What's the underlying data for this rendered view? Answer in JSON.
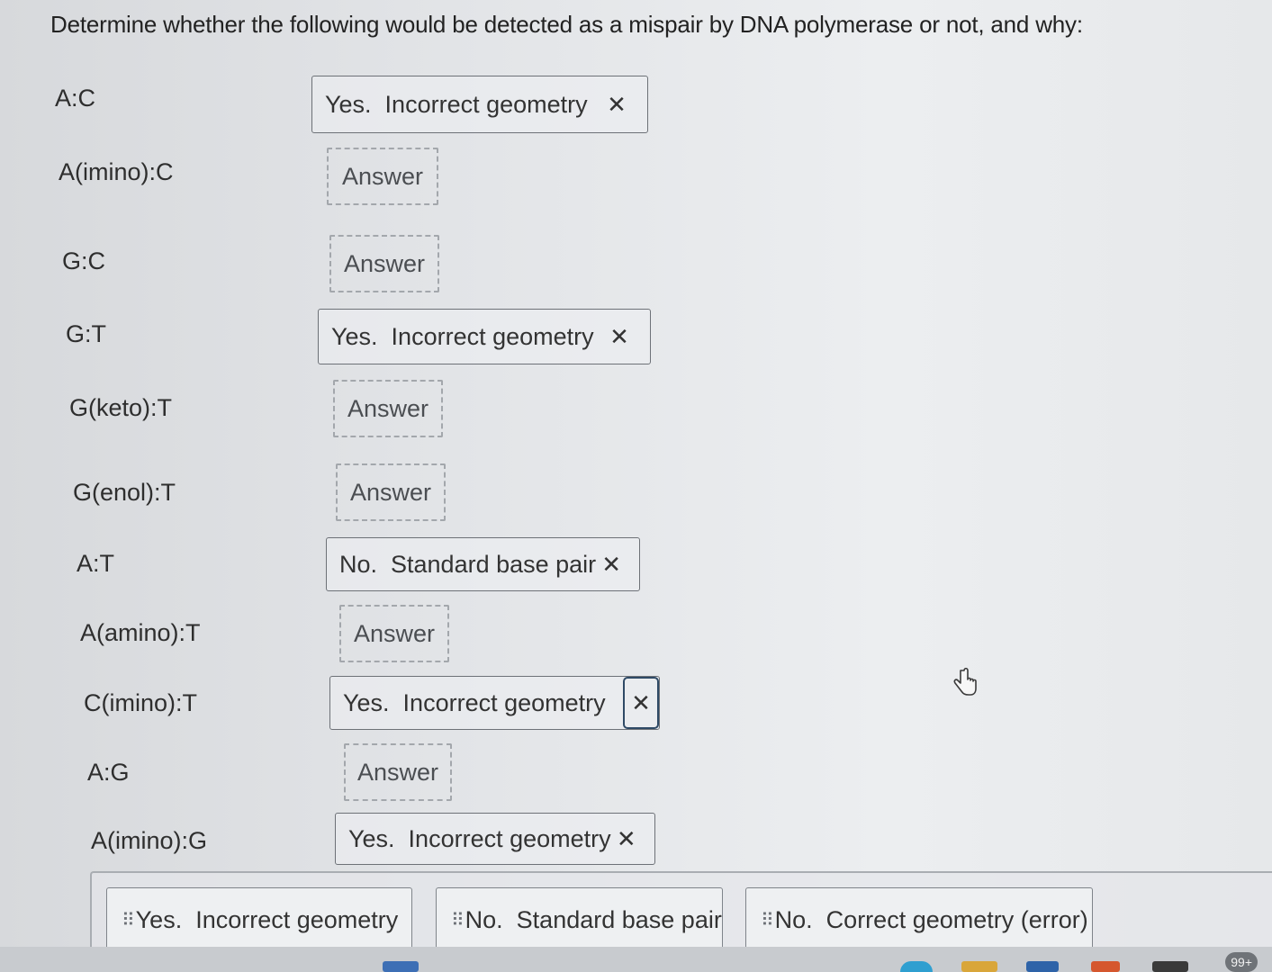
{
  "question": "Determine whether the following would be detected as a mispair by DNA polymerase or not, and why:",
  "rows": [
    {
      "label": "A:C",
      "answer": "Yes.  Incorrect geometry",
      "filled": true
    },
    {
      "label": "A(imino):C",
      "answer": "Answer",
      "filled": false
    },
    {
      "label": "G:C",
      "answer": "Answer",
      "filled": false
    },
    {
      "label": "G:T",
      "answer": "Yes.  Incorrect geometry",
      "filled": true
    },
    {
      "label": "G(keto):T",
      "answer": "Answer",
      "filled": false
    },
    {
      "label": "G(enol):T",
      "answer": "Answer",
      "filled": false
    },
    {
      "label": "A:T",
      "answer": "No.  Standard base pair",
      "filled": true
    },
    {
      "label": "A(amino):T",
      "answer": "Answer",
      "filled": false
    },
    {
      "label": "C(imino):T",
      "answer": "Yes.  Incorrect geometry",
      "filled": true
    },
    {
      "label": "A:G",
      "answer": "Answer",
      "filled": false
    },
    {
      "label": "A(imino):G",
      "answer": "Yes.  Incorrect geometry",
      "filled": true
    }
  ],
  "remove_symbol": "✕",
  "answer_bank": [
    "Yes.  Incorrect geometry",
    "No.  Standard base pair",
    "No.  Correct geometry (error)"
  ],
  "taskbar": {
    "badge": "99+"
  },
  "icons": {
    "remove": "close-icon",
    "drag": "grip-icon",
    "cursor": "hand-pointer-icon"
  }
}
